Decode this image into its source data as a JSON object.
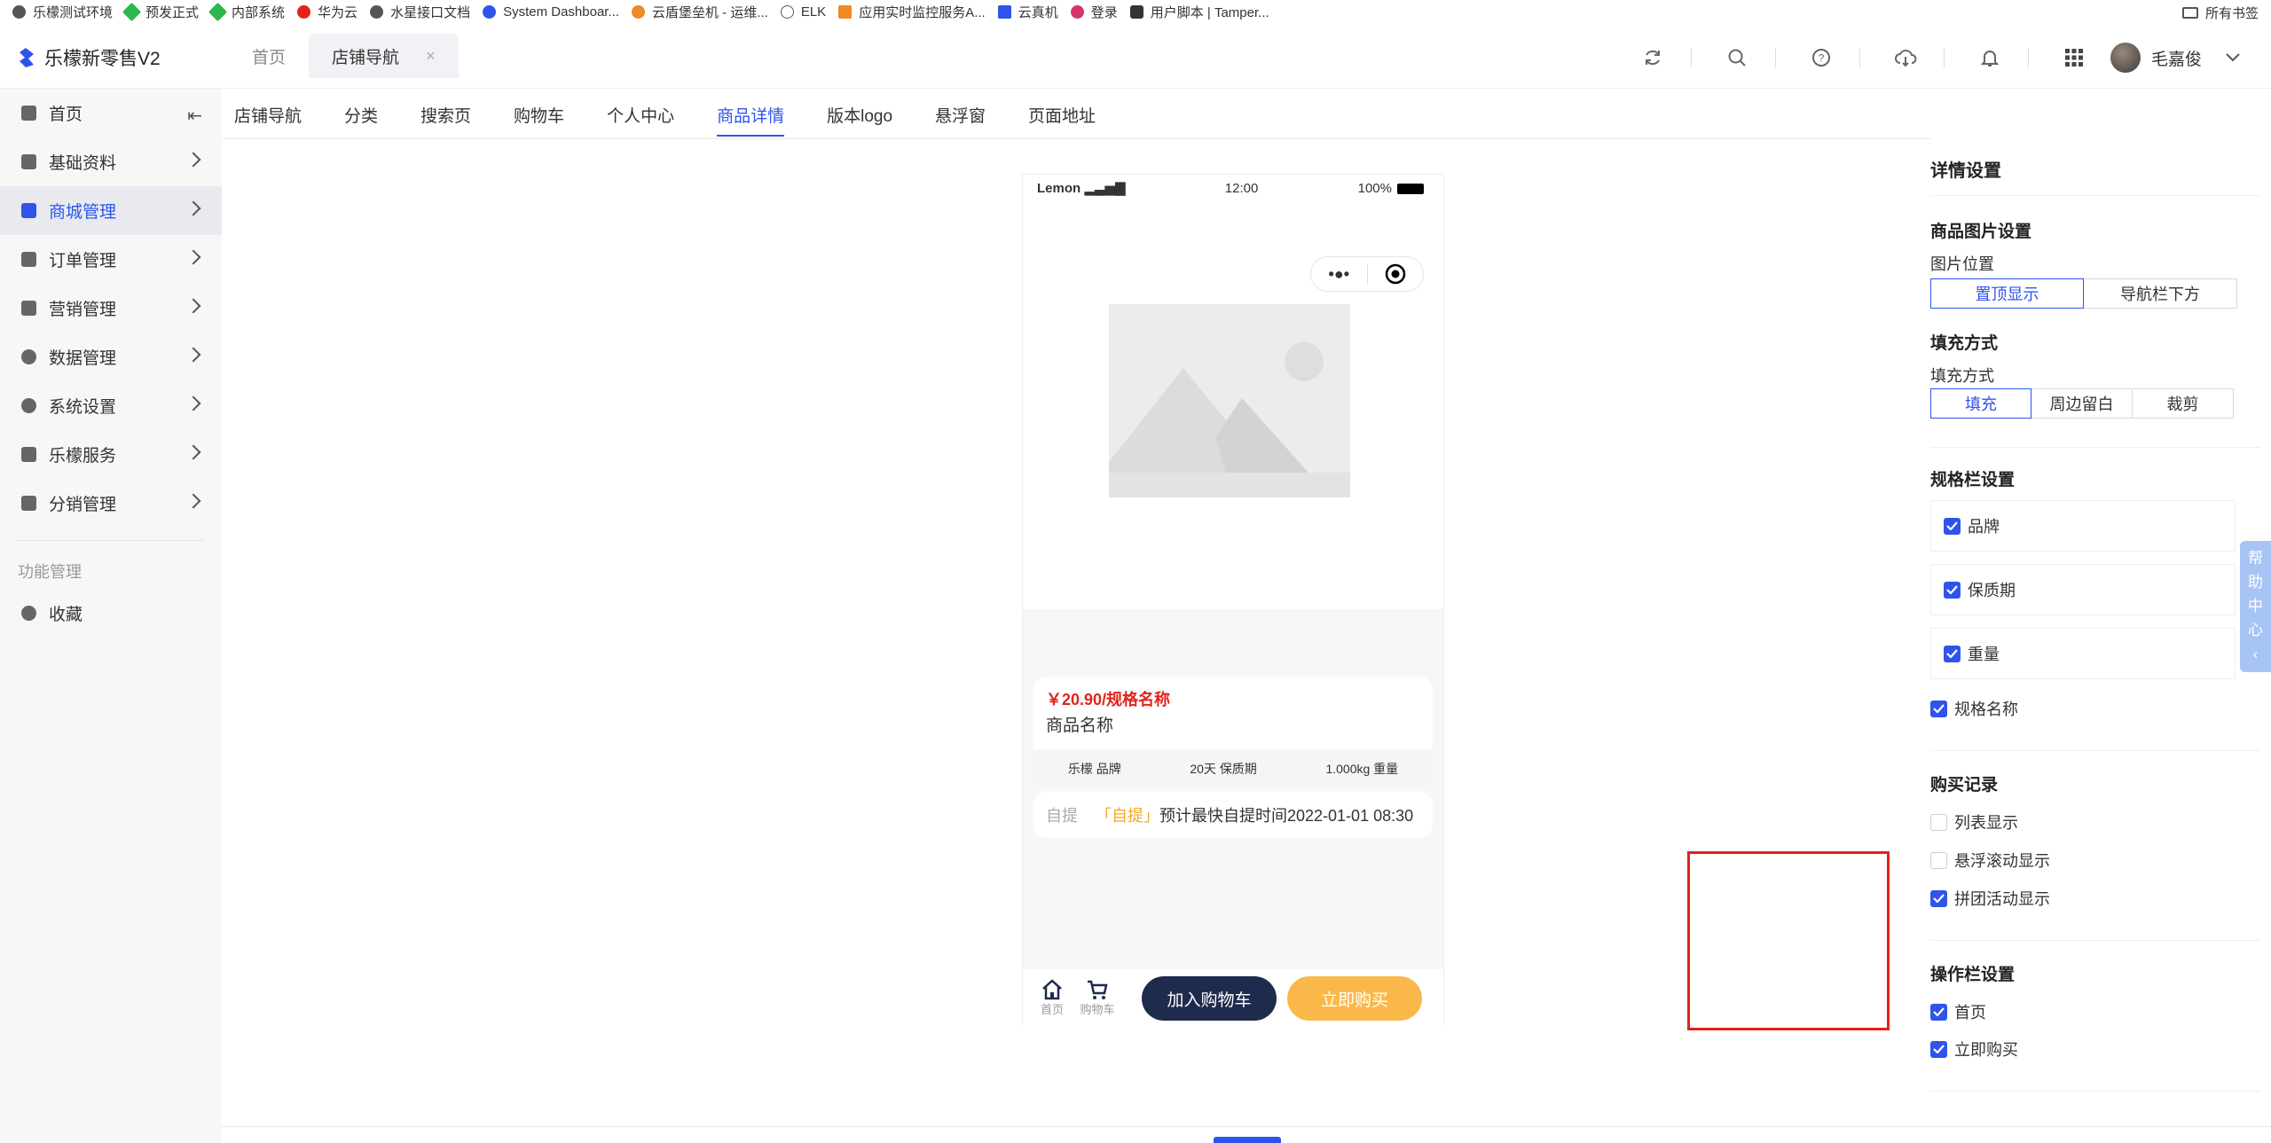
{
  "bookmarks": {
    "items": [
      {
        "label": "乐檬测试环境",
        "color": "#555555"
      },
      {
        "label": "预发正式",
        "color": "#2db84d"
      },
      {
        "label": "内部系统",
        "color": "#2db84d"
      },
      {
        "label": "华为云",
        "color": "#e2231a"
      },
      {
        "label": "水星接口文档",
        "color": "#555555"
      },
      {
        "label": "System Dashboar...",
        "color": "#2f54eb"
      },
      {
        "label": "云盾堡垒机 - 运维...",
        "color": "#f08a24"
      },
      {
        "label": "ELK",
        "color": "#555555"
      },
      {
        "label": "应用实时监控服务A...",
        "color": "#f08a24"
      },
      {
        "label": "云真机",
        "color": "#2f54eb"
      },
      {
        "label": "登录",
        "color": "#d6336c"
      },
      {
        "label": "用户脚本 | Tamper...",
        "color": "#333333"
      }
    ],
    "all_label": "所有书签"
  },
  "app": {
    "title": "乐檬新零售V2",
    "tabs": [
      {
        "label": "首页"
      },
      {
        "label": "店铺导航"
      }
    ],
    "user": "毛嘉俊",
    "accent": "#2f54eb"
  },
  "sidebar": {
    "items": [
      {
        "label": "首页"
      },
      {
        "label": "基础资料"
      },
      {
        "label": "商城管理"
      },
      {
        "label": "订单管理"
      },
      {
        "label": "营销管理"
      },
      {
        "label": "数据管理"
      },
      {
        "label": "系统设置"
      },
      {
        "label": "乐檬服务"
      },
      {
        "label": "分销管理"
      }
    ],
    "group_label": "功能管理",
    "fav_label": "收藏"
  },
  "subtabs": [
    "店铺导航",
    "分类",
    "搜索页",
    "购物车",
    "个人中心",
    "商品详情",
    "版本logo",
    "悬浮窗",
    "页面地址"
  ],
  "phone": {
    "carrier": "Lemon",
    "time": "12:00",
    "battery": "100%",
    "price": "￥20.90/规格名称",
    "product_name": "商品名称",
    "specs": [
      {
        "value": "乐檬",
        "label": "品牌"
      },
      {
        "value": "20天",
        "label": "保质期"
      },
      {
        "value": "1.000kg",
        "label": "重量"
      }
    ],
    "pickup_label": "自提",
    "pickup_tag": "「自提」",
    "pickup_text": "预计最快自提时间2022-01-01 08:30",
    "nav_home": "首页",
    "nav_cart": "购物车",
    "btn_add_cart": "加入购物车",
    "btn_buy": "立即购买"
  },
  "settings": {
    "title": "详情设置",
    "image_section": "商品图片设置",
    "image_pos_label": "图片位置",
    "image_pos_options": [
      "置顶显示",
      "导航栏下方"
    ],
    "fill_section": "填充方式",
    "fill_label": "填充方式",
    "fill_options": [
      "填充",
      "周边留白",
      "裁剪"
    ],
    "spec_section": "规格栏设置",
    "spec_items": [
      "品牌",
      "保质期",
      "重量"
    ],
    "spec_name": "规格名称",
    "purchase_section": "购买记录",
    "purchase_items": [
      "列表显示",
      "悬浮滚动显示",
      "拼团活动显示"
    ],
    "action_section": "操作栏设置",
    "action_items": [
      "首页",
      "立即购买"
    ]
  },
  "help": [
    "帮",
    "助",
    "中",
    "心",
    "‹"
  ]
}
